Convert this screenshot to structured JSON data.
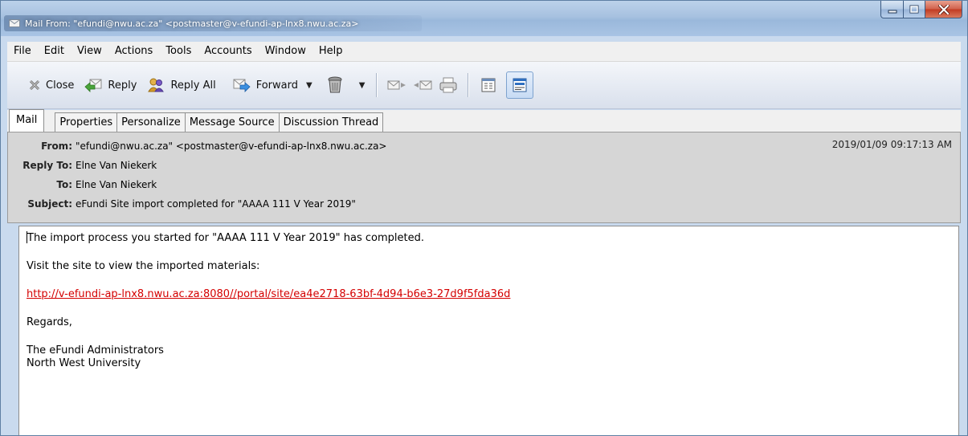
{
  "window": {
    "title": "Mail From: \"efundi@nwu.ac.za\" <postmaster@v-efundi-ap-lnx8.nwu.ac.za>"
  },
  "menu": {
    "items": [
      "File",
      "Edit",
      "View",
      "Actions",
      "Tools",
      "Accounts",
      "Window",
      "Help"
    ]
  },
  "toolbar": {
    "close_label": "Close",
    "reply_label": "Reply",
    "reply_all_label": "Reply All",
    "forward_label": "Forward",
    "icons": [
      "close-icon",
      "reply-icon",
      "reply-all-icon",
      "forward-icon",
      "delete-trash-icon",
      "previous-message-icon",
      "next-message-icon",
      "print-icon",
      "header-layout-icon",
      "preview-layout-icon"
    ]
  },
  "tabs": [
    "Mail",
    "Properties",
    "Personalize",
    "Message Source",
    "Discussion Thread"
  ],
  "header": {
    "from_label": "From:",
    "from_value": "\"efundi@nwu.ac.za\" <postmaster@v-efundi-ap-lnx8.nwu.ac.za>",
    "reply_to_label": "Reply To:",
    "reply_to_value": "Elne Van Niekerk",
    "to_label": "To:",
    "to_value": "Elne Van Niekerk",
    "subject_label": "Subject:",
    "subject_value": "eFundi Site import completed for \"AAAA 111 V Year 2019\"",
    "date": "2019/01/09 09:17:13 AM"
  },
  "body": {
    "line1": "The import process you started for \"AAAA 111 V Year 2019\" has completed.",
    "line2": "Visit the site to view the imported materials:",
    "link": "http://v-efundi-ap-lnx8.nwu.ac.za:8080//portal/site/ea4e2718-63bf-4d94-b6e3-27d9f5fda36d",
    "line3": "Regards,",
    "signature1": "The eFundi Administrators",
    "signature2": "North West University"
  },
  "colors": {
    "link": "#d40000",
    "header_bg": "#d6d6d6",
    "titlebar": "#a7c1e0"
  }
}
